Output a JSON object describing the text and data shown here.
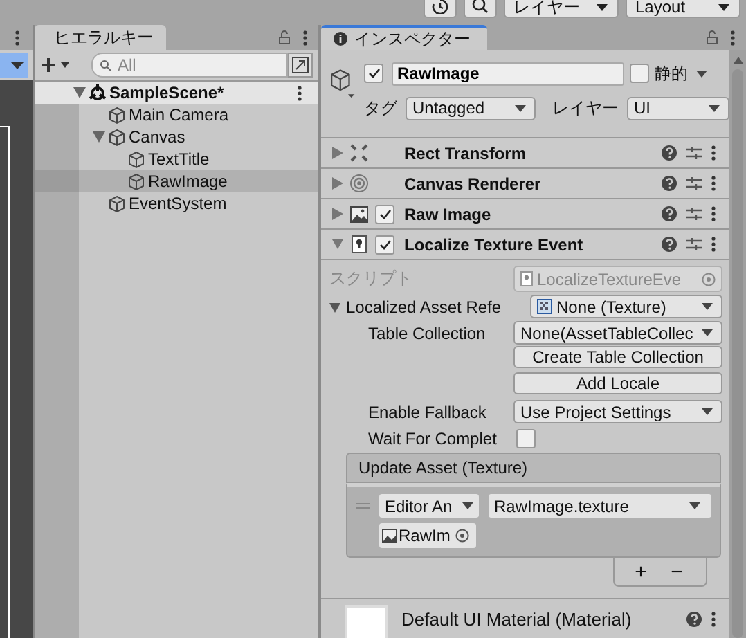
{
  "toolbar": {
    "dropdowns": [
      "レイヤー",
      "Layout"
    ]
  },
  "hierarchy": {
    "title": "ヒエラルキー",
    "search": {
      "placeholder": "All"
    },
    "tree": [
      {
        "label": "SampleScene*",
        "kind": "scene",
        "expanded": true,
        "selected": false,
        "children": [
          {
            "label": "Main Camera",
            "kind": "object",
            "selected": false
          },
          {
            "label": "Canvas",
            "kind": "object",
            "expanded": true,
            "selected": false,
            "children": [
              {
                "label": "TextTitle",
                "kind": "object",
                "selected": false
              },
              {
                "label": "RawImage",
                "kind": "object",
                "selected": true
              }
            ]
          },
          {
            "label": "EventSystem",
            "kind": "object",
            "selected": false
          }
        ]
      }
    ]
  },
  "inspector": {
    "title": "インスペクター",
    "object": {
      "active": true,
      "name": "RawImage",
      "static": false,
      "static_label": "静的",
      "tag_label": "タグ",
      "tag": "Untagged",
      "layer_label": "レイヤー",
      "layer": "UI"
    },
    "components": [
      {
        "name": "Rect Transform",
        "expanded": false
      },
      {
        "name": "Canvas Renderer",
        "expanded": false
      },
      {
        "name": "Raw Image",
        "expanded": false,
        "enabled": true
      },
      {
        "name": "Localize Texture Event",
        "expanded": true,
        "enabled": true
      }
    ],
    "fields": [
      {
        "kind": "object",
        "label": "スクリプト",
        "value": "LocalizeTextureEve",
        "disabled": true
      },
      {
        "kind": "object_dropdown",
        "label": "Localized Asset Refe",
        "value": "None (Texture)",
        "expanded": true
      },
      {
        "kind": "dropdown",
        "label": "Table Collection",
        "value": "None(AssetTableCollec"
      },
      {
        "kind": "button",
        "value": "Create Table Collection"
      },
      {
        "kind": "button",
        "value": "Add Locale"
      },
      {
        "kind": "dropdown",
        "label": "Enable Fallback",
        "value": "Use Project Settings"
      },
      {
        "kind": "checkbox",
        "label": "Wait For Complet",
        "checked": false
      }
    ],
    "event": {
      "title": "Update Asset (Texture)",
      "entries": [
        {
          "mode": "Editor An",
          "target": "RawIm",
          "function": "RawImage.texture"
        }
      ],
      "buttons": [
        "+",
        "−"
      ]
    },
    "material": {
      "name": "Default UI Material (Material)"
    }
  }
}
